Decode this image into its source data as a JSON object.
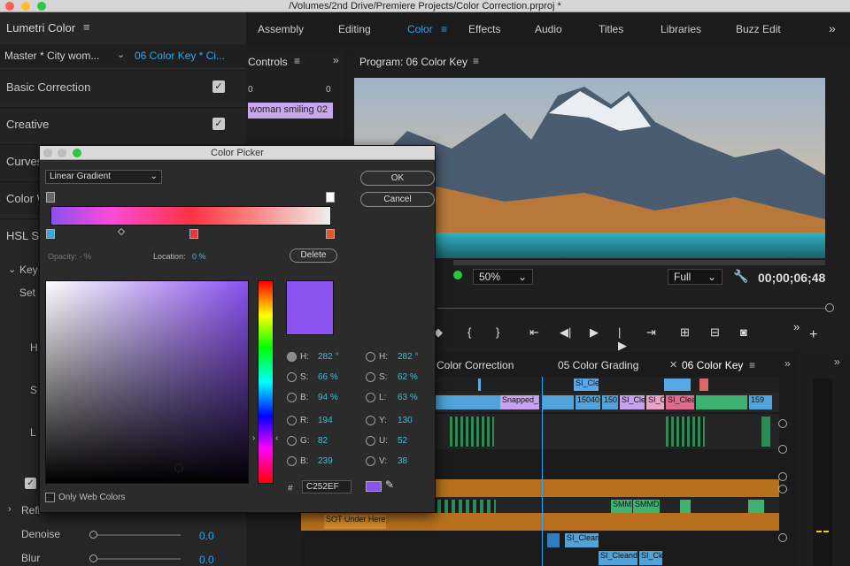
{
  "window": {
    "title": "/Volumes/2nd Drive/Premiere Projects/Color Correction.prproj *"
  },
  "workspaces": [
    "Assembly",
    "Editing",
    "Color",
    "Effects",
    "Audio",
    "Titles",
    "Libraries",
    "Buzz Edit"
  ],
  "lumetri": {
    "title": "Lumetri Color",
    "master": "Master * City wom...",
    "sequence": "06 Color Key * Ci...",
    "sections": [
      "Basic Correction",
      "Creative",
      "Curves",
      "Color W",
      "HSL Se"
    ],
    "key_label": "Key",
    "set_label": "Set",
    "h_label": "H",
    "s_label": "S",
    "l_label": "L",
    "refine_label": "Refi",
    "denoise": {
      "label": "Denoise",
      "value": "0.0"
    },
    "blur": {
      "label": "Blur",
      "value": "0.0"
    }
  },
  "controls": {
    "title": "Controls",
    "zero_a": "0",
    "zero_b": "0",
    "clip_name": "woman smiling 02"
  },
  "program": {
    "title": "Program: 06 Color Key",
    "zoom": "50%",
    "quality": "Full",
    "timecode": "00;00;06;48"
  },
  "timeline": {
    "tabs": [
      "Color Correction",
      "05 Color Grading",
      "06 Color Key"
    ],
    "clips": [
      "SI_Clea",
      "Snapped_S",
      "15040",
      "150",
      "SI_Cle",
      "SI_C",
      "SI_Clea",
      "SMMI",
      "SMMDI",
      "SOT Under Here",
      "SI_Clean",
      "SI_Cleand",
      "SI_Ck",
      "159"
    ]
  },
  "color_picker": {
    "title": "Color Picker",
    "gradient_type": "Linear Gradient",
    "ok": "OK",
    "cancel": "Cancel",
    "opacity": "Opacity: - %",
    "location_label": "Location:",
    "location_value": "0 %",
    "delete": "Delete",
    "hsb": [
      {
        "label": "H:",
        "value": "282 °"
      },
      {
        "label": "S:",
        "value": "66 %"
      },
      {
        "label": "B:",
        "value": "94 %"
      }
    ],
    "hsl": [
      {
        "label": "H:",
        "value": "282 °"
      },
      {
        "label": "S:",
        "value": "62 %"
      },
      {
        "label": "L:",
        "value": "63 %"
      }
    ],
    "rgb": [
      {
        "label": "R:",
        "value": "194"
      },
      {
        "label": "G:",
        "value": "82"
      },
      {
        "label": "B:",
        "value": "239"
      }
    ],
    "yuv": [
      {
        "label": "Y:",
        "value": "130"
      },
      {
        "label": "U:",
        "value": "52"
      },
      {
        "label": "V:",
        "value": "38"
      }
    ],
    "hash": "#",
    "hex": "C252EF",
    "web_colors": "Only Web Colors",
    "swatch_color": "#8a52ef"
  },
  "colors": {
    "accent": "#2ec6d6",
    "blue_tab": "#2aa7f0"
  }
}
